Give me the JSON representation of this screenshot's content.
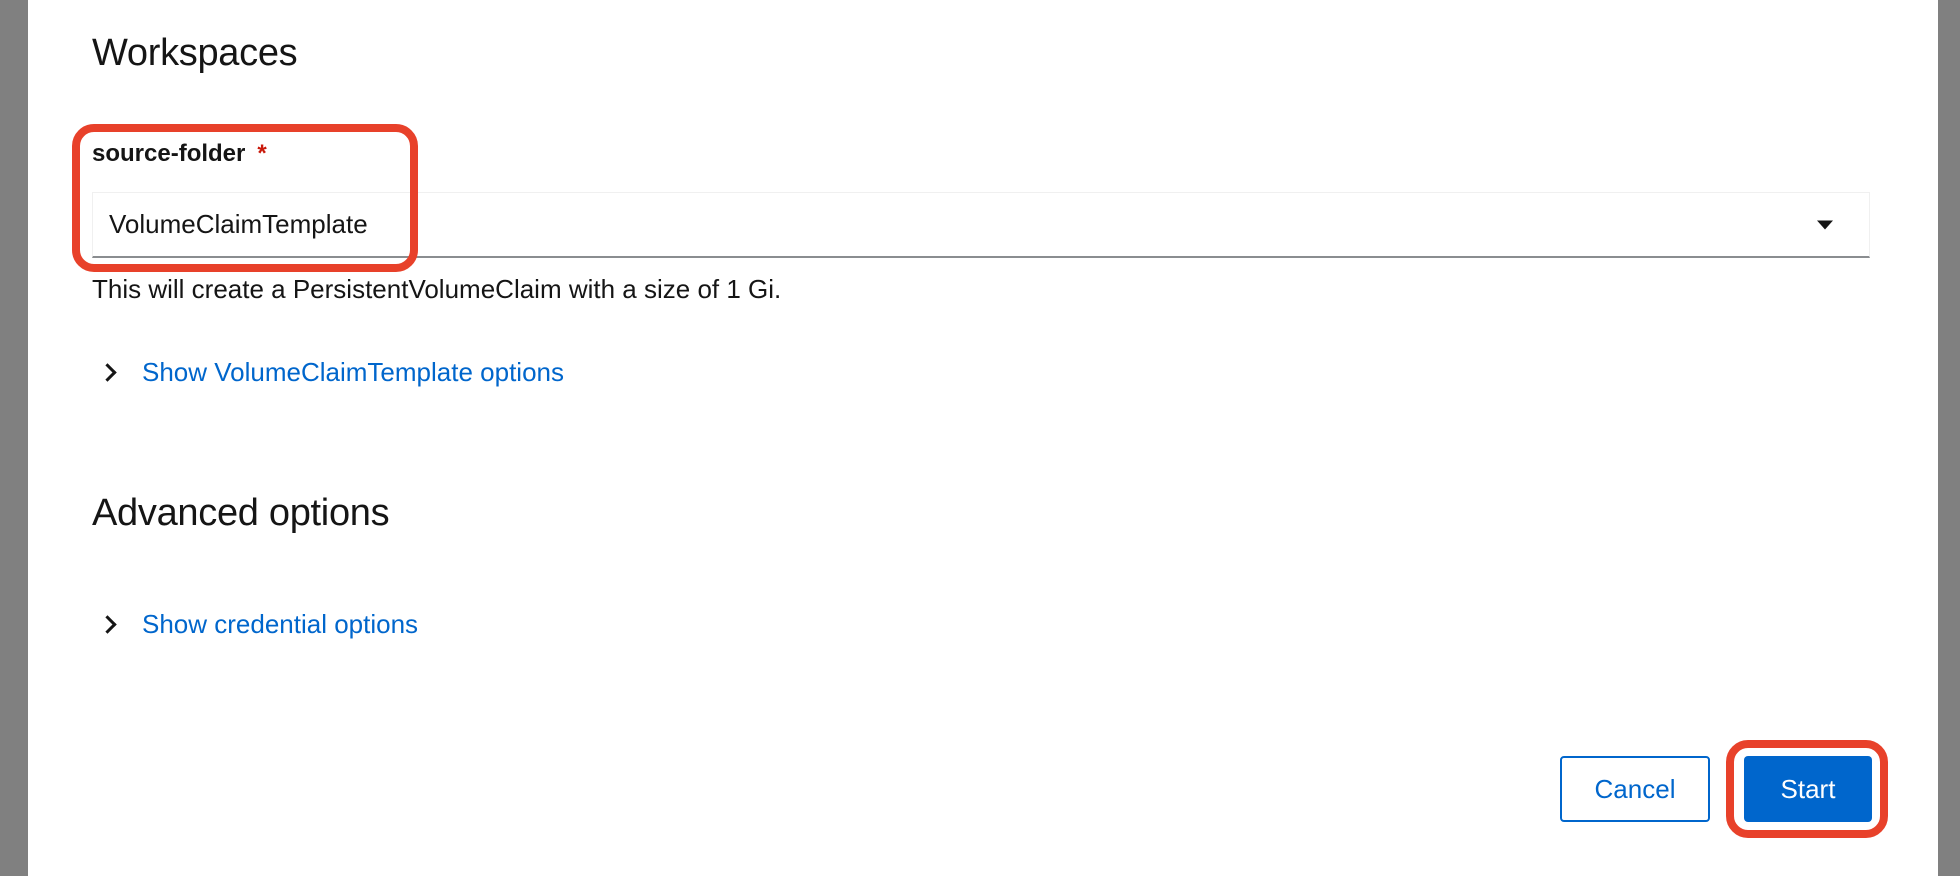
{
  "workspaces": {
    "title": "Workspaces",
    "field": {
      "label": "source-folder",
      "required_marker": "*",
      "selected_value": "VolumeClaimTemplate",
      "helper_text": "This will create a PersistentVolumeClaim with a size of 1 Gi."
    },
    "expandable_label": "Show VolumeClaimTemplate options"
  },
  "advanced": {
    "title": "Advanced options",
    "expandable_label": "Show credential options"
  },
  "footer": {
    "cancel_label": "Cancel",
    "start_label": "Start"
  },
  "colors": {
    "primary": "#0066cc",
    "required": "#c9190b",
    "highlight": "#e8412a",
    "overlay": "#808080"
  },
  "icons": {
    "select_caret": "caret-down-icon",
    "expand_toggle": "chevron-right-icon"
  }
}
